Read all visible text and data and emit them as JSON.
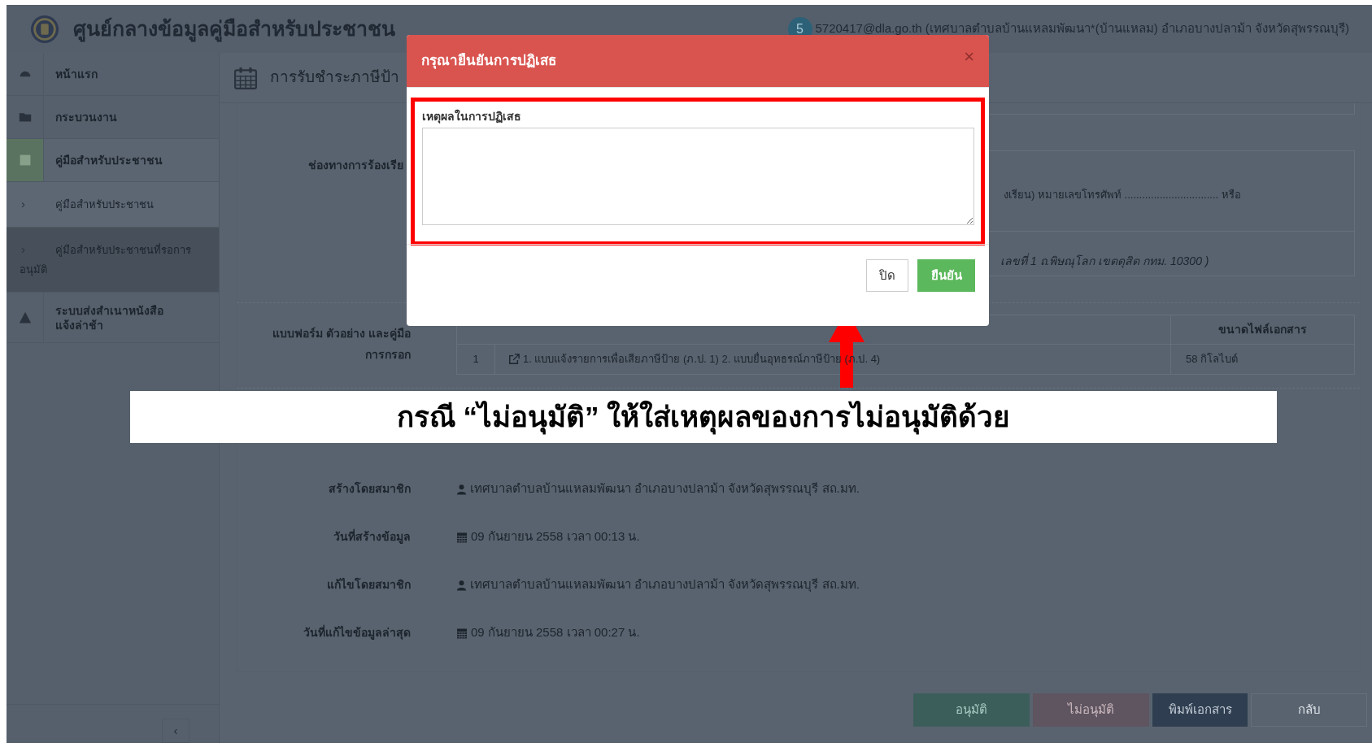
{
  "header": {
    "title": "ศูนย์กลางข้อมูลคู่มือสำหรับประชาชน",
    "avatar": "5",
    "user": "5720417@dla.go.th (เทศบาลตำบลบ้านแหลมพัฒนา*(บ้านแหลม) อำเภอบางปลาม้า จังหวัดสุพรรณบุรี)"
  },
  "sidebar": {
    "items": [
      {
        "label": "หน้าแรก",
        "kind": "main",
        "selected": false
      },
      {
        "label": "กระบวนงาน",
        "kind": "main",
        "selected": false
      },
      {
        "label": "คู่มือสำหรับประชาชน",
        "kind": "main",
        "selected": true
      },
      {
        "label": "คู่มือสำหรับประชาชน",
        "kind": "sub",
        "marker": "›",
        "selected": false
      },
      {
        "label": "คู่มือสำหรับประชาชนที่รอการอนุมัติ",
        "kind": "sub",
        "marker": "›",
        "selected": true
      },
      {
        "label": "ระบบส่งสำเนาหนังสือแจ้งล่าช้า",
        "kind": "main",
        "selected": false
      }
    ],
    "collapse": "‹"
  },
  "page": {
    "heading": "การรับชำระภาษีป้า",
    "complaint": {
      "label": "ช่องทางการร้องเรีย",
      "phone": "งเรียน) หมายเลขโทรศัพท์ ................................ หรือ",
      "address": "เลขที่ 1 ถ.พิษณุโลก เขตดุสิต กทม. 10300 )"
    },
    "forms": {
      "label_lines": [
        "แบบฟอร์ม ตัวอย่าง และคู่มือ",
        "การกรอก"
      ],
      "size_column": "ขนาดไฟล์เอกสาร",
      "rows": [
        {
          "number": "1",
          "document": "1. แบบแจ้งรายการเพื่อเสียภาษีป้าย (ภ.ป. 1) 2. แบบยื่นอุทธรณ์ภาษีป้าย (ภ.ป. 4)",
          "size": "58 กิโลไบต์"
        }
      ]
    },
    "info": [
      {
        "label": "สร้างโดยสมาชิก",
        "kind": "user",
        "value": "เทศบาลตำบลบ้านแหลมพัฒนา อำเภอบางปลาม้า จังหวัดสุพรรณบุรี สถ.มท."
      },
      {
        "label": "วันที่สร้างข้อมูล",
        "kind": "date",
        "value": "09 กันยายน 2558 เวลา 00:13 น."
      },
      {
        "label": "แก้ไขโดยสมาชิก",
        "kind": "user",
        "value": "เทศบาลตำบลบ้านแหลมพัฒนา อำเภอบางปลาม้า จังหวัดสุพรรณบุรี สถ.มท."
      },
      {
        "label": "วันที่แก้ไขข้อมูลล่าสุด",
        "kind": "date",
        "value": "09 กันยายน 2558 เวลา 00:27 น."
      }
    ],
    "actions": [
      {
        "label": "อนุมัติ",
        "kind": "approve"
      },
      {
        "label": "ไม่อนุมัติ",
        "kind": "reject"
      },
      {
        "label": "พิมพ์เอกสาร",
        "kind": "print"
      },
      {
        "label": "กลับ",
        "kind": "back"
      }
    ]
  },
  "modal": {
    "title": "กรุณายืนยันการปฏิเสธ",
    "close": "×",
    "field_label": "เหตุผลในการปฏิเสธ",
    "buttons": [
      {
        "label": "ปิด",
        "kind": "default"
      },
      {
        "label": "ยืนยัน",
        "kind": "confirm"
      }
    ]
  },
  "annotation": {
    "text": "กรณี “ไม่อนุมัติ” ให้ใส่เหตุผลของการไม่อนุมัติด้วย"
  }
}
